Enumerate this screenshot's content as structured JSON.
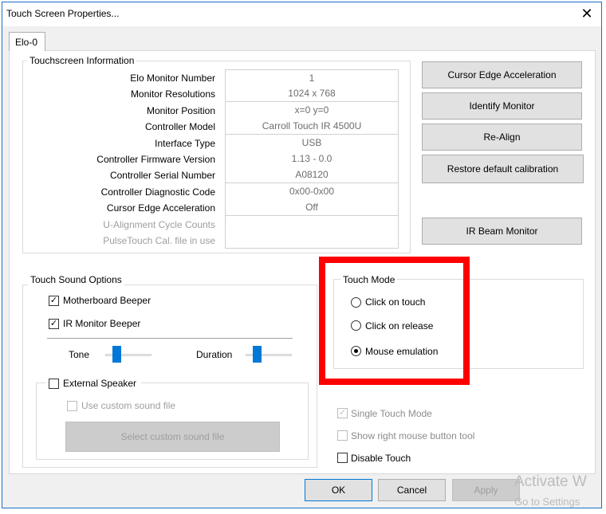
{
  "window": {
    "title": "Touch Screen Properties...",
    "close_glyph": "✕"
  },
  "tab": {
    "label": "Elo-0"
  },
  "touchscreen_info": {
    "legend": "Touchscreen Information",
    "rows": [
      {
        "label": "Elo Monitor Number",
        "value": "1"
      },
      {
        "label": "Monitor Resolutions",
        "value": "1024 x 768"
      },
      {
        "label": "Monitor Position",
        "value": "x=0  y=0"
      },
      {
        "label": "Controller Model",
        "value": "Carroll Touch IR 4500U"
      },
      {
        "label": "Interface Type",
        "value": "USB"
      },
      {
        "label": "Controller Firmware Version",
        "value": "1.13 - 0.0"
      },
      {
        "label": "Controller Serial Number",
        "value": "A08120"
      },
      {
        "label": "Controller Diagnostic Code",
        "value": "0x00-0x00"
      },
      {
        "label": "Cursor Edge Acceleration",
        "value": "Off"
      },
      {
        "label": "U-Alignment Cycle Counts",
        "value": ""
      },
      {
        "label": "PulseTouch Cal. file in use",
        "value": ""
      }
    ]
  },
  "side_buttons": {
    "cursor_edge": "Cursor Edge Acceleration",
    "identify": "Identify Monitor",
    "realign": "Re-Align",
    "restore": "Restore default calibration",
    "ir_beam": "IR Beam Monitor"
  },
  "sound": {
    "legend": "Touch Sound Options",
    "motherboard_beeper": "Motherboard Beeper",
    "ir_monitor_beeper": "IR Monitor Beeper",
    "tone_label": "Tone",
    "duration_label": "Duration",
    "tone_level": 0.2,
    "duration_level": 0.2,
    "external_speaker": "External Speaker",
    "use_custom_file": "Use custom sound file",
    "select_custom_file": "Select custom sound file",
    "check_glyph": "✓"
  },
  "touch_mode": {
    "legend": "Touch Mode",
    "options": [
      "Click on touch",
      "Click on release",
      "Mouse emulation"
    ],
    "selected": "Mouse emulation",
    "highlight_color": "#ff0000"
  },
  "options": {
    "single_touch": "Single Touch Mode",
    "show_right_mouse": "Show right mouse button tool",
    "disable_touch": "Disable Touch"
  },
  "footer": {
    "ok": "OK",
    "cancel": "Cancel",
    "apply": "Apply"
  },
  "watermark": {
    "line1": "Activate W",
    "line2": "Go to Settings"
  }
}
